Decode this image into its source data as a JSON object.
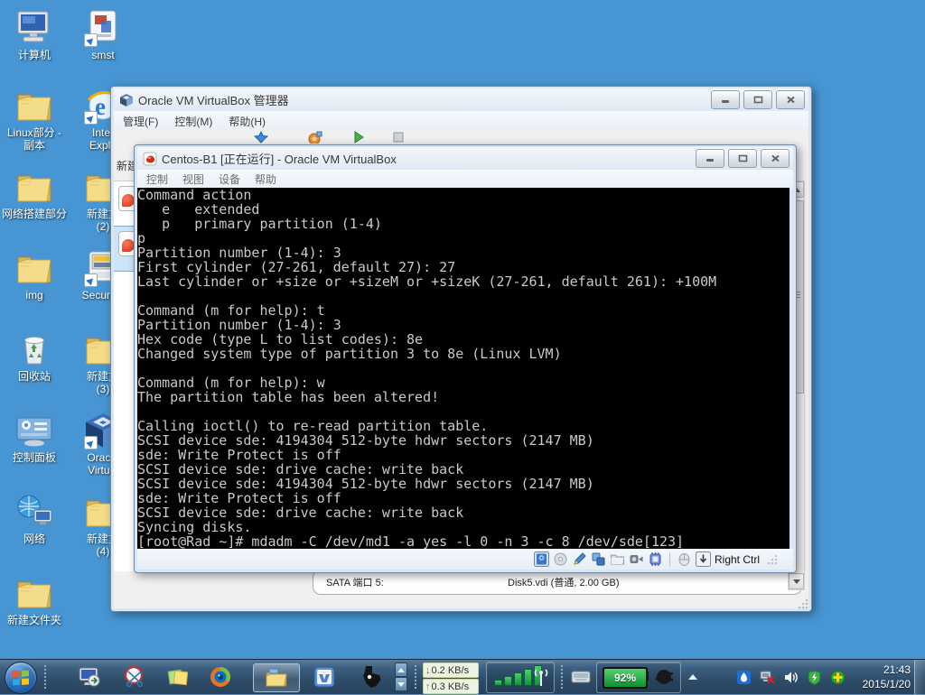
{
  "colors": {
    "desktop_bg": "#4795d2",
    "taskbar_bg": "#2e4c69",
    "terminal_bg": "#000000",
    "terminal_fg": "#c9c9c9",
    "selection_blue": "#cde3f8",
    "battery_green": "#0f8f34"
  },
  "desktop": {
    "icons": [
      {
        "name": "computer",
        "icon": "computer",
        "label": [
          "计算机"
        ],
        "col": 0,
        "row": 0,
        "shortcut": false
      },
      {
        "name": "smst-shortcut",
        "icon": "app-doc",
        "label": [
          "smst"
        ],
        "col": 1,
        "row": 0,
        "shortcut": true
      },
      {
        "name": "linux-folder-copy",
        "icon": "folder",
        "label": [
          "Linux部分 -",
          "副本"
        ],
        "col": 0,
        "row": 1,
        "shortcut": false
      },
      {
        "name": "internet-explorer",
        "icon": "ie",
        "label": [
          "Inter",
          "Explo"
        ],
        "col": 1,
        "row": 1,
        "shortcut": true
      },
      {
        "name": "network-build-folder",
        "icon": "folder",
        "label": [
          "网络搭建部分"
        ],
        "col": 0,
        "row": 2,
        "shortcut": false
      },
      {
        "name": "new-folder-2",
        "icon": "folder",
        "label": [
          "新建文",
          "(2)"
        ],
        "col": 1,
        "row": 2,
        "shortcut": false
      },
      {
        "name": "img-folder",
        "icon": "folder",
        "label": [
          "img"
        ],
        "col": 0,
        "row": 3,
        "shortcut": false
      },
      {
        "name": "securecrt",
        "icon": "securecrt",
        "label": [
          "SecureC"
        ],
        "col": 1,
        "row": 3,
        "shortcut": true
      },
      {
        "name": "recycle-bin",
        "icon": "recycle",
        "label": [
          "回收站"
        ],
        "col": 0,
        "row": 4,
        "shortcut": false
      },
      {
        "name": "new-folder-3",
        "icon": "folder",
        "label": [
          "新建文",
          "(3)"
        ],
        "col": 1,
        "row": 4,
        "shortcut": false
      },
      {
        "name": "control-panel",
        "icon": "control-panel",
        "label": [
          "控制面板"
        ],
        "col": 0,
        "row": 5,
        "shortcut": false
      },
      {
        "name": "oracle-virtualbox",
        "icon": "virtualbox",
        "label": [
          "Oracle",
          "Virtual"
        ],
        "col": 1,
        "row": 5,
        "shortcut": true
      },
      {
        "name": "network",
        "icon": "network",
        "label": [
          "网络"
        ],
        "col": 0,
        "row": 6,
        "shortcut": false
      },
      {
        "name": "new-folder-4",
        "icon": "folder",
        "label": [
          "新建文",
          "(4)"
        ],
        "col": 1,
        "row": 6,
        "shortcut": false
      },
      {
        "name": "new-folder",
        "icon": "folder",
        "label": [
          "新建文件夹"
        ],
        "col": 0,
        "row": 7,
        "shortcut": false
      }
    ]
  },
  "manager_window": {
    "title": "Oracle VM VirtualBox 管理器",
    "menu": [
      "管理(F)",
      "控制(M)",
      "帮助(H)"
    ],
    "toolbar_clipped_label": "新建",
    "toolbar_fragments": [
      "new-vm",
      "settings",
      "start",
      "discard"
    ],
    "vm_list": [
      {
        "selected": false
      },
      {
        "selected": true
      }
    ],
    "details": {
      "field": "SATA 端口 5:",
      "value": "Disk5.vdi (普通, 2.00 GB)"
    }
  },
  "vm_window": {
    "title": "Centos-B1 [正在运行] - Oracle VM VirtualBox",
    "menu": [
      "控制",
      "视图",
      "设备",
      "帮助"
    ],
    "hostkey_label": "Right Ctrl",
    "status_icons": [
      "harddisk",
      "optical-disc",
      "pen",
      "network-adapters",
      "shared-folder",
      "video-capture",
      "usb-chip",
      "separator",
      "mouse-integration",
      "hostkey-capture"
    ],
    "terminal_lines": [
      "Command action",
      "   e   extended",
      "   p   primary partition (1-4)",
      "p",
      "Partition number (1-4): 3",
      "First cylinder (27-261, default 27): 27",
      "Last cylinder or +size or +sizeM or +sizeK (27-261, default 261): +100M",
      "",
      "Command (m for help): t",
      "Partition number (1-4): 3",
      "Hex code (type L to list codes): 8e",
      "Changed system type of partition 3 to 8e (Linux LVM)",
      "",
      "Command (m for help): w",
      "The partition table has been altered!",
      "",
      "Calling ioctl() to re-read partition table.",
      "SCSI device sde: 4194304 512-byte hdwr sectors (2147 MB)",
      "sde: Write Protect is off",
      "SCSI device sde: drive cache: write back",
      "SCSI device sde: 4194304 512-byte hdwr sectors (2147 MB)",
      "sde: Write Protect is off",
      "SCSI device sde: drive cache: write back",
      "Syncing disks.",
      "[root@Rad ~]# mdadm -C /dev/md1 -a yes -l 0 -n 3 -c 8 /dev/sde[123]_"
    ]
  },
  "taskbar": {
    "apps": [
      {
        "name": "remote-desktop",
        "active": false
      },
      {
        "name": "snipping-tool",
        "active": false
      },
      {
        "name": "sticky-notes",
        "active": false
      },
      {
        "name": "browser-360",
        "active": false
      },
      {
        "name": "explorer",
        "active": true
      },
      {
        "name": "vmware",
        "active": false
      },
      {
        "name": "texas-app",
        "active": false
      }
    ],
    "net": {
      "down": "0.2 KB/s",
      "up": "0.3 KB/s"
    },
    "battery": {
      "percent": "92%"
    },
    "tray_icons": [
      "security-blue",
      "network-disconnected",
      "volume",
      "shield-green",
      "health-plus"
    ],
    "clock": {
      "time": "21:43",
      "date": "2015/1/20"
    }
  }
}
